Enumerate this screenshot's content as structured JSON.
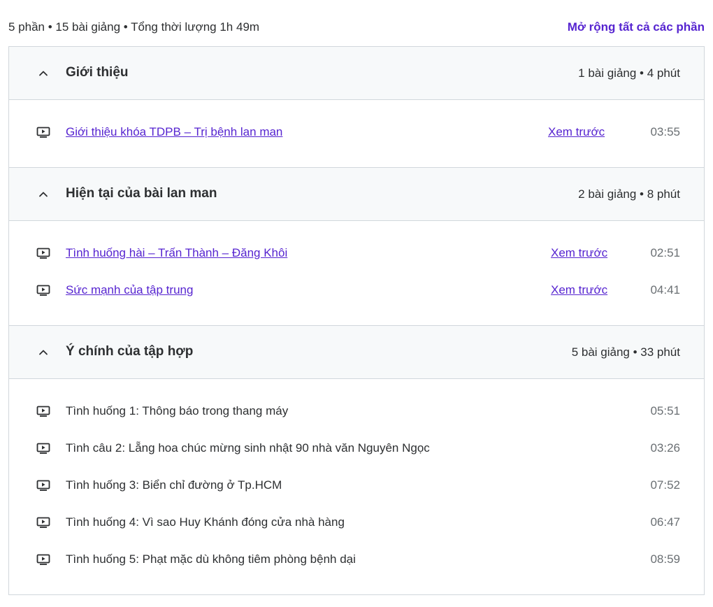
{
  "summary": "5 phần • 15 bài giảng • Tổng thời lượng 1h 49m",
  "expand_all": "Mở rộng tất cả các phần",
  "sections": [
    {
      "title": "Giới thiệu",
      "meta": "1 bài giảng • 4 phút",
      "lectures": [
        {
          "title": "Giới thiệu khóa TDPB – Trị bệnh lan man",
          "preview": "Xem trước",
          "duration": "03:55"
        }
      ]
    },
    {
      "title": "Hiện tại của bài lan man",
      "meta": "2 bài giảng • 8 phút",
      "lectures": [
        {
          "title": "Tình huống hài – Trấn Thành – Đăng Khôi",
          "preview": "Xem trước",
          "duration": "02:51"
        },
        {
          "title": "Sức mạnh của tập trung",
          "preview": "Xem trước",
          "duration": "04:41"
        }
      ]
    },
    {
      "title": "Ý chính của tập hợp",
      "meta": "5 bài giảng • 33 phút",
      "lectures": [
        {
          "title": "Tình huống 1: Thông báo trong thang máy",
          "duration": "05:51"
        },
        {
          "title": "Tình câu 2: Lẵng hoa chúc mừng sinh nhật 90 nhà văn Nguyên Ngọc",
          "duration": "03:26"
        },
        {
          "title": "Tình huống 3: Biển chỉ đường ở Tp.HCM",
          "duration": "07:52"
        },
        {
          "title": "Tình huống 4: Vì sao Huy Khánh đóng cửa nhà hàng",
          "duration": "06:47"
        },
        {
          "title": "Tình huống 5: Phạt mặc dù không tiêm phòng bệnh dại",
          "duration": "08:59"
        }
      ]
    }
  ],
  "colors": {
    "accent": "#5624d0",
    "header_bg": "#f7f9fa",
    "border": "#d1d7dc",
    "muted": "#6a6f73"
  },
  "icons": {
    "section_toggle": "chevron-up-icon",
    "lecture": "video-icon"
  }
}
